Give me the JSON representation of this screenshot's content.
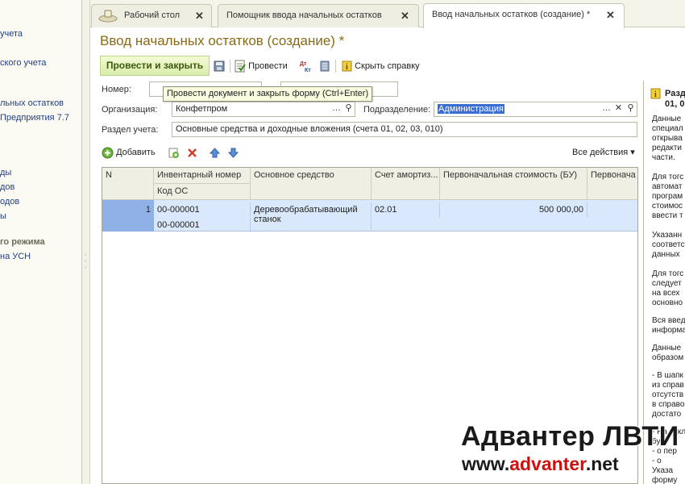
{
  "left_panel": {
    "items": [
      {
        "label": "учета",
        "bold": false
      },
      {
        "label": "ского учета",
        "bold": false
      },
      {
        "label": "льных остатков",
        "bold": false
      },
      {
        "label": "Предприятия 7.7",
        "bold": false
      },
      {
        "label": "ды",
        "bold": false
      },
      {
        "label": "дов",
        "bold": false
      },
      {
        "label": "одов",
        "bold": false
      },
      {
        "label": "ы",
        "bold": false
      },
      {
        "label": "го режима",
        "bold": true
      },
      {
        "label": "на УСН",
        "bold": false
      }
    ]
  },
  "tabs": [
    {
      "label": "Рабочий стол",
      "icon": "desktop-icon"
    },
    {
      "label": "Помощник ввода начальных остатков"
    },
    {
      "label": "Ввод начальных остатков (создание) *",
      "active": true
    }
  ],
  "form": {
    "title": "Ввод начальных остатков (создание) *",
    "toolbar": {
      "post_and_close": "Провести и закрыть",
      "post": "Провести",
      "hide_help": "Скрыть справку"
    },
    "tooltip": "Провести документ и закрыть форму (Ctrl+Enter)",
    "fields": {
      "number_label": "Номер:",
      "organization_label": "Организация:",
      "organization_value": "Конфетпром",
      "division_label": "Подразделение:",
      "division_value": "Администрация",
      "section_label": "Раздел учета:",
      "section_value": "Основные средства и доходные вложения (счета 01, 02, 03, 010)"
    },
    "table_toolbar": {
      "add": "Добавить",
      "all_actions": "Все действия"
    },
    "table": {
      "headers": {
        "n": "N",
        "inventory_number": "Инвентарный номер",
        "os_code": "Код ОС",
        "asset": "Основное средство",
        "depr_account": "Счет амортиз...",
        "initial_cost_bu": "Первоначальная стоимость (БУ)",
        "initial_cost_next": "Первонача"
      },
      "rows": [
        {
          "n": "1",
          "inventory_number": "00-000001",
          "os_code": "00-000001",
          "asset_line1": "Деревообрабатывающий",
          "asset_line2": "станок",
          "depr_account": "02.01",
          "initial_cost_bu": "500 000,00"
        }
      ]
    }
  },
  "help_panel": {
    "title_line1": "Разд",
    "title_line2": "01, 0",
    "lines": [
      "Данные",
      "специал",
      "открыва",
      "редакти",
      "части.",
      "Для тогс",
      "автомат",
      "програм",
      "стоимос",
      "ввести т",
      "Указанн",
      "соответс",
      "данных",
      "Для тогс",
      "следует",
      "на всех",
      "основно",
      "Вся введ",
      "информа",
      "Данные",
      "образом",
      "- В шапк",
      "из справ",
      "отсутств",
      "в справо",
      "достато",
      "- На закл",
      "бухг",
      "- о пер",
      "- о",
      "Указа",
      "форму"
    ]
  },
  "watermark": {
    "line1": "Адвантер ЛВТИ",
    "line2_prefix": "www.",
    "line2_brand": "advanter",
    "line2_suffix": ".net"
  },
  "colors": {
    "title": "#8a6a14",
    "primary_button": "#d7ecaa",
    "selection": "#3b6ed3",
    "selected_row": "#d9e8fb"
  }
}
